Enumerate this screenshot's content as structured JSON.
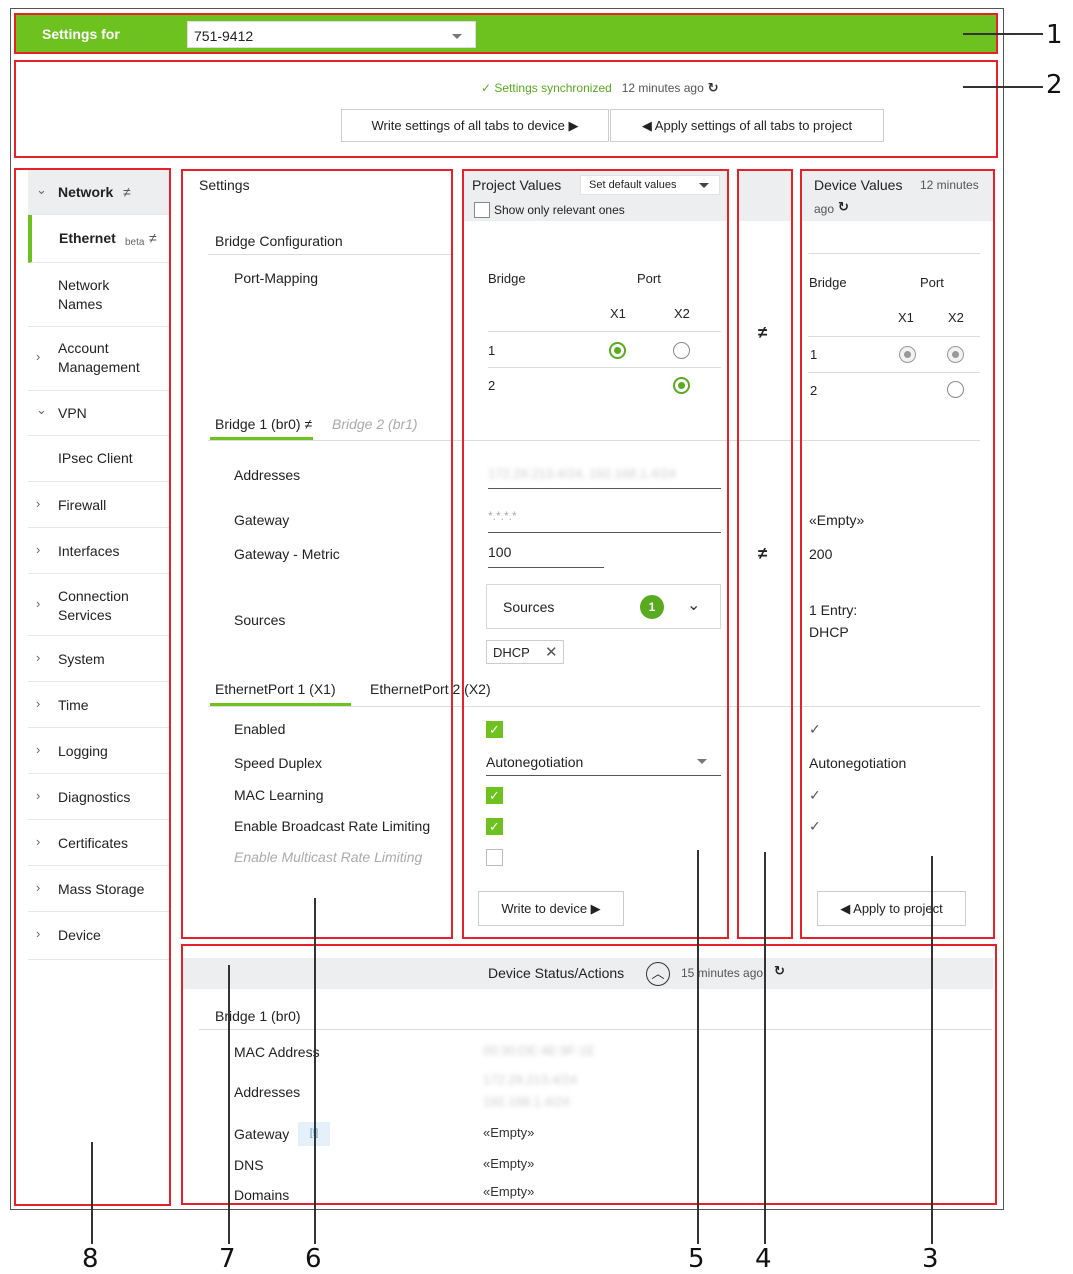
{
  "header": {
    "settings_for_label": "Settings for",
    "device_value": "751-9412"
  },
  "sync": {
    "status": "✓ Settings synchronized",
    "age": "12 minutes ago",
    "write_all_button": "Write settings of all tabs to device ▶",
    "apply_all_button": "◀ Apply settings of all tabs to project"
  },
  "sidebar": {
    "items": [
      {
        "label": "Network",
        "suffix": "≠",
        "chevron": "⌄"
      },
      {
        "label": "Ethernet",
        "sub": "beta",
        "suffix": "≠"
      },
      {
        "label": "Network\nNames"
      },
      {
        "label": "Account\nManagement",
        "chevron": "›"
      },
      {
        "label": "VPN",
        "chevron": "⌄"
      },
      {
        "label": "IPsec Client"
      },
      {
        "label": "Firewall",
        "chevron": "›"
      },
      {
        "label": "Interfaces",
        "chevron": "›"
      },
      {
        "label": "Connection\nServices",
        "chevron": "›"
      },
      {
        "label": "System",
        "chevron": "›"
      },
      {
        "label": "Time",
        "chevron": "›"
      },
      {
        "label": "Logging",
        "chevron": "›"
      },
      {
        "label": "Diagnostics",
        "chevron": "›"
      },
      {
        "label": "Certificates",
        "chevron": "›"
      },
      {
        "label": "Mass Storage",
        "chevron": "›"
      },
      {
        "label": "Device",
        "chevron": "›"
      }
    ]
  },
  "settings": {
    "header": "Settings",
    "bridge_config": "Bridge Configuration",
    "port_mapping": "Port-Mapping",
    "tab_bridge1": "Bridge 1 (br0)",
    "tab_bridge1_suffix": "≠",
    "tab_bridge2": "Bridge 2 (br1)",
    "addresses": "Addresses",
    "gateway": "Gateway",
    "gateway_metric": "Gateway - Metric",
    "sources": "Sources",
    "tab_port1": "EthernetPort 1 (X1)",
    "tab_port2": "EthernetPort 2 (X2)",
    "enabled": "Enabled",
    "speed_duplex": "Speed Duplex",
    "mac_learning": "MAC Learning",
    "broadcast_limit": "Enable Broadcast Rate Limiting",
    "multicast_limit": "Enable Multicast Rate Limiting"
  },
  "project": {
    "header": "Project Values",
    "defaults_select": "Set default values",
    "relevant_only": "Show only relevant ones",
    "col_bridge": "Bridge",
    "col_port": "Port",
    "col_x1": "X1",
    "col_x2": "X2",
    "row1": "1",
    "row2": "2",
    "addresses_blurred": "172.29.213.4/24, 192.168.1.4/24",
    "gateway_placeholder": "*.*.*.*",
    "metric": "100",
    "sources_label": "Sources",
    "sources_count": "1",
    "dhcp_chip": "DHCP",
    "speed_value": "Autonegotiation",
    "write_button": "Write to device ▶"
  },
  "diff": {
    "mark": "≠"
  },
  "device": {
    "header": "Device Values",
    "age_line1": "12 minutes",
    "age_line2": "ago",
    "col_bridge": "Bridge",
    "col_port": "Port",
    "col_x1": "X1",
    "col_x2": "X2",
    "row1": "1",
    "row2": "2",
    "gateway": "«Empty»",
    "metric": "200",
    "sources_line1": "1 Entry:",
    "sources_line2": "DHCP",
    "enabled": "✓",
    "speed": "Autonegotiation",
    "mac_learning": "✓",
    "broadcast": "✓",
    "apply_button": "◀ Apply to project"
  },
  "status": {
    "header": "Device Status/Actions",
    "age": "15 minutes ago",
    "bridge": "Bridge 1 (br0)",
    "mac_label": "MAC Address",
    "mac_blurred": "00:30:DE:4E:9F:1E",
    "addresses_label": "Addresses",
    "addr1_blurred": "172.29.213.4/24",
    "addr2_blurred": "192.168.1.4/24",
    "gateway_label": "Gateway",
    "gateway_badge": "[!]",
    "gateway_value": "«Empty»",
    "dns_label": "DNS",
    "dns_value": "«Empty»",
    "domains_label": "Domains",
    "domains_value": "«Empty»"
  },
  "callouts": [
    "1",
    "2",
    "3",
    "4",
    "5",
    "6",
    "7",
    "8"
  ],
  "colors": {
    "accent_green": "#6ec21f",
    "callout_red": "#e8202a"
  }
}
